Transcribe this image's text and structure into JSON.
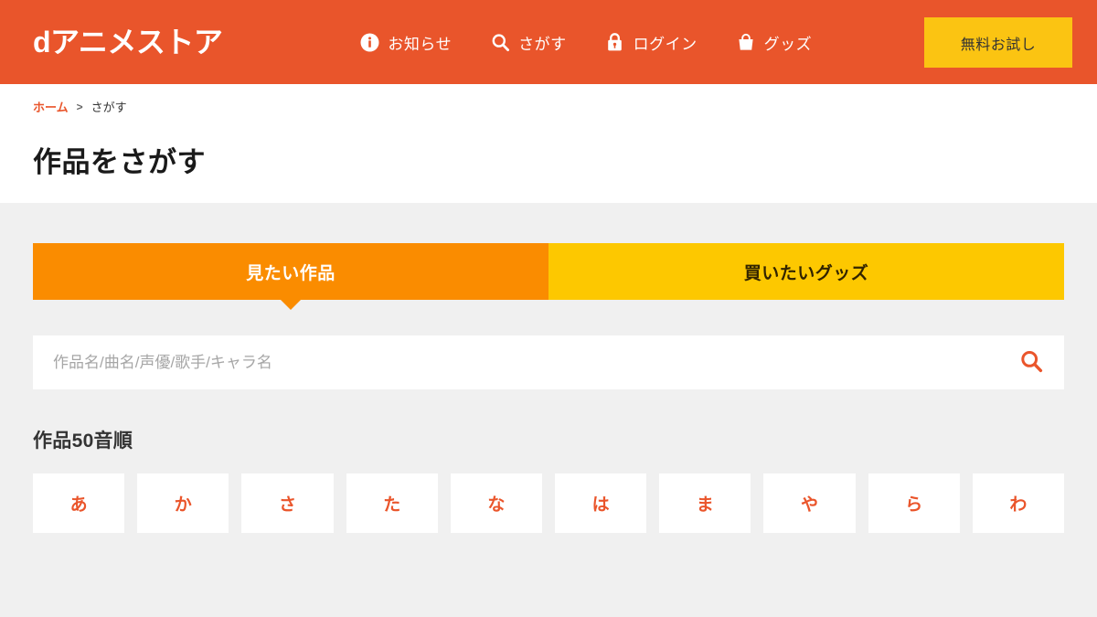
{
  "header": {
    "logo_text": "dアニメストア",
    "logo_name": "d-anime-store-logo",
    "background_color": "#e9552b",
    "nav": [
      {
        "label": "お知らせ",
        "icon": "info-icon"
      },
      {
        "label": "さがす",
        "icon": "search-icon"
      },
      {
        "label": "ログイン",
        "icon": "lock-icon"
      },
      {
        "label": "グッズ",
        "icon": "shopping-bag-icon"
      }
    ],
    "trial_button": {
      "label": "無料お試し",
      "background_color": "#fbc412",
      "text_color": "#333333"
    }
  },
  "breadcrumb": {
    "home_label": "ホーム",
    "separator": ">",
    "current_label": "さがす"
  },
  "page": {
    "title": "作品をさがす"
  },
  "tabs": [
    {
      "label": "見たい作品",
      "state": "active",
      "background_color": "#fa8c00",
      "text_color": "#ffffff"
    },
    {
      "label": "買いたいグッズ",
      "state": "inactive",
      "background_color": "#fdc800",
      "text_color": "#322400"
    }
  ],
  "search": {
    "value": "",
    "placeholder": "作品名/曲名/声優/歌手/キャラ名",
    "button_icon": "search-icon",
    "icon_color": "#ea552b"
  },
  "kana_section": {
    "title": "作品50音順",
    "accent_color": "#ea552b",
    "items": [
      {
        "label": "あ"
      },
      {
        "label": "か"
      },
      {
        "label": "さ"
      },
      {
        "label": "た"
      },
      {
        "label": "な"
      },
      {
        "label": "は"
      },
      {
        "label": "ま"
      },
      {
        "label": "や"
      },
      {
        "label": "ら"
      },
      {
        "label": "わ"
      }
    ]
  }
}
